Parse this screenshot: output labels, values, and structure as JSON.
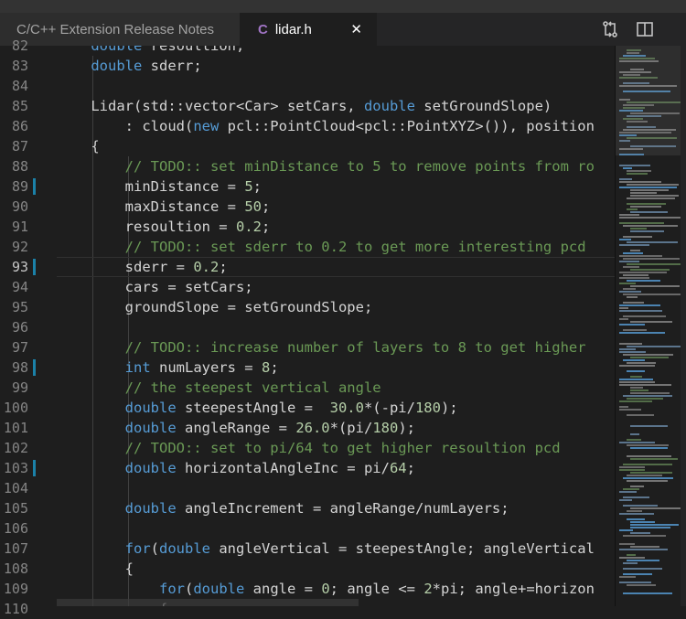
{
  "tabs": [
    {
      "label": "C/C++ Extension Release Notes",
      "active": false
    },
    {
      "label": "lidar.h",
      "icon_text": "C",
      "active": true
    }
  ],
  "close_glyph": "✕",
  "toolbar_icons": [
    "open-changes-icon",
    "split-editor-icon"
  ],
  "editor": {
    "active_line": 93,
    "lines": [
      {
        "num": "82",
        "html": "    <span class=\"kw\">double</span> resoultion;"
      },
      {
        "num": "83",
        "html": "    <span class=\"kw\">double</span> sderr;"
      },
      {
        "num": "84",
        "html": ""
      },
      {
        "num": "85",
        "html": "    Lidar(std::vector&lt;Car&gt; setCars, <span class=\"kw\">double</span> setGroundSlope)"
      },
      {
        "num": "86",
        "html": "        : cloud(<span class=\"kw\">new</span> pcl::PointCloud&lt;pcl::PointXYZ&gt;()), position"
      },
      {
        "num": "87",
        "html": "    {"
      },
      {
        "num": "88",
        "html": "        <span class=\"cm\">// TODO:: set minDistance to 5 to remove points from ro</span>"
      },
      {
        "num": "89",
        "html": "        minDistance = <span class=\"nm\">5</span>;",
        "changed": true
      },
      {
        "num": "90",
        "html": "        maxDistance = <span class=\"nm\">50</span>;"
      },
      {
        "num": "91",
        "html": "        resoultion = <span class=\"nm\">0.2</span>;"
      },
      {
        "num": "92",
        "html": "        <span class=\"cm\">// TODO:: set sderr to 0.2 to get more interesting pcd</span>"
      },
      {
        "num": "93",
        "html": "        sderr = <span class=\"nm\">0.2</span>;",
        "changed": true
      },
      {
        "num": "94",
        "html": "        cars = setCars;"
      },
      {
        "num": "95",
        "html": "        groundSlope = setGroundSlope;"
      },
      {
        "num": "96",
        "html": ""
      },
      {
        "num": "97",
        "html": "        <span class=\"cm\">// TODO:: increase number of layers to 8 to get higher</span>"
      },
      {
        "num": "98",
        "html": "        <span class=\"kw\">int</span> numLayers = <span class=\"nm\">8</span>;",
        "changed": true
      },
      {
        "num": "99",
        "html": "        <span class=\"cm\">// the steepest vertical angle</span>"
      },
      {
        "num": "100",
        "html": "        <span class=\"kw\">double</span> steepestAngle =  <span class=\"nm\">30.0</span>*(-pi/<span class=\"nm\">180</span>);"
      },
      {
        "num": "101",
        "html": "        <span class=\"kw\">double</span> angleRange = <span class=\"nm\">26.0</span>*(pi/<span class=\"nm\">180</span>);"
      },
      {
        "num": "102",
        "html": "        <span class=\"cm\">// TODO:: set to pi/64 to get higher resoultion pcd</span>"
      },
      {
        "num": "103",
        "html": "        <span class=\"kw\">double</span> horizontalAngleInc = pi/<span class=\"nm\">64</span>;",
        "changed": true
      },
      {
        "num": "104",
        "html": ""
      },
      {
        "num": "105",
        "html": "        <span class=\"kw\">double</span> angleIncrement = angleRange/numLayers;"
      },
      {
        "num": "106",
        "html": ""
      },
      {
        "num": "107",
        "html": "        <span class=\"kw\">for</span>(<span class=\"kw\">double</span> angleVertical = steepestAngle; angleVertical"
      },
      {
        "num": "108",
        "html": "        {"
      },
      {
        "num": "109",
        "html": "            <span class=\"kw\">for</span>(<span class=\"kw\">double</span> angle = <span class=\"nm\">0</span>; angle &lt;= <span class=\"nm\">2</span>*pi; angle+=horizon"
      },
      {
        "num": "110",
        "html": "            {"
      }
    ]
  }
}
